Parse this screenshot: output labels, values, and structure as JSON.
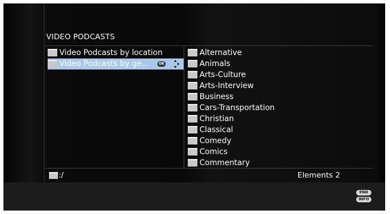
{
  "header": {
    "title": "VIDEO PODCASTS"
  },
  "left_list": {
    "items": [
      {
        "label": "Video Podcasts by location",
        "selected": false
      },
      {
        "label": "Video Podcasts by ge...",
        "selected": true
      }
    ],
    "ok_badge": "OK"
  },
  "right_list": {
    "items": [
      "Alternative",
      "Animals",
      "Arts-Culture",
      "Arts-Interview",
      "Business",
      "Cars-Transportation",
      "Christian",
      "Classical",
      "Comedy",
      "Comics",
      "Commentary"
    ]
  },
  "status": {
    "path": ":/",
    "elements": "Elements 2"
  },
  "remote_buttons": {
    "end": "END",
    "info": "INFO"
  },
  "colors": {
    "selection": "#a8c9ea",
    "background": "#000000",
    "folder": "#c9c9c9"
  }
}
